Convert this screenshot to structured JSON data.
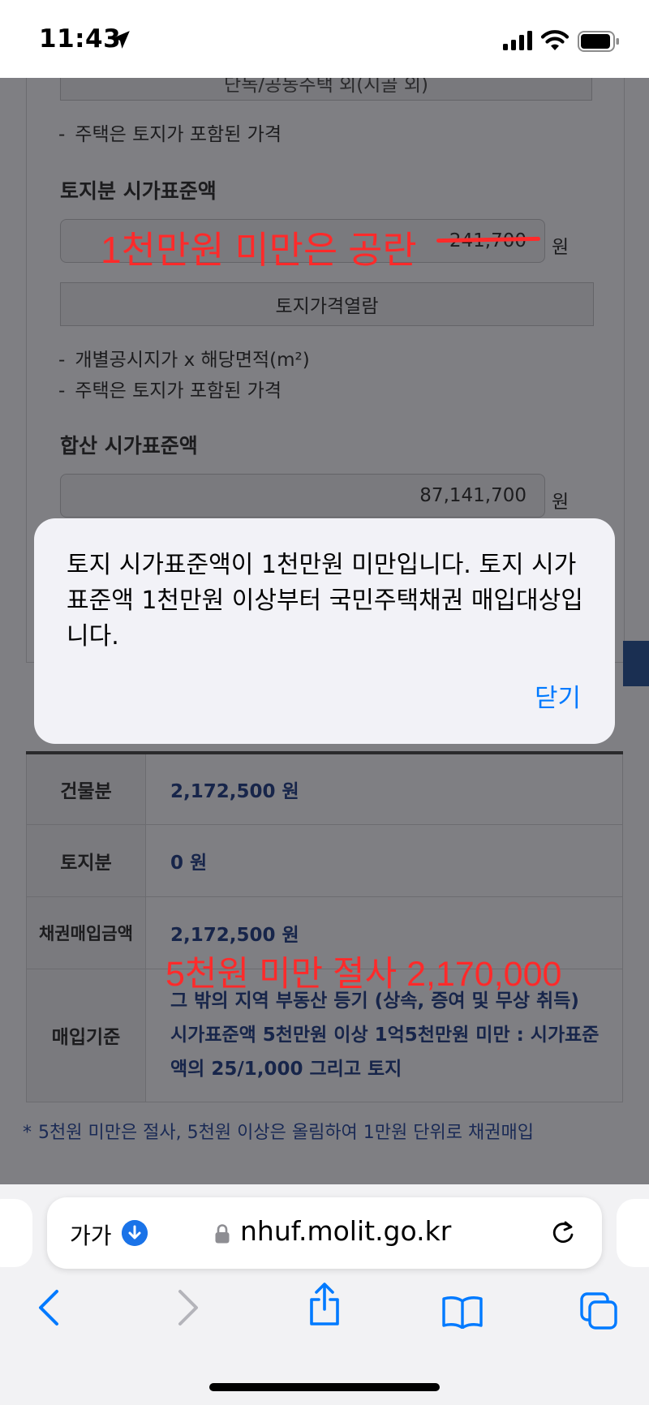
{
  "status_bar": {
    "time": "11:43"
  },
  "page": {
    "top_partial_button": "단독/공동주택 외(시골 외)",
    "note_house_land_1": "주택은 토지가 포함된 가격",
    "land_section_title": "토지분 시가표준액",
    "land_value": "241,700",
    "unit_won": "원",
    "land_price_button": "토지가격열람",
    "note_official_price": "개별공시지가 x 해당면적(m²)",
    "note_house_land_2": "주택은 토지가 포함된 가격",
    "total_section_title": "합산 시가표준액",
    "total_value": "87,141,700",
    "note_dash": "-"
  },
  "annotations": {
    "land_blank": "1천만원 미만은 공란",
    "truncate_note": "5천원 미만 절사 2,170,000"
  },
  "alert": {
    "message": "토지 시가표준액이 1천만원 미만입니다. 토지 시가표준액 1천만원 이상부터 국민주택채권 매입대상입니다.",
    "close_label": "닫기"
  },
  "result_table": {
    "rows": [
      {
        "label": "건물분",
        "value": "2,172,500 원"
      },
      {
        "label": "토지분",
        "value": "0 원"
      },
      {
        "label": "채권매입금액",
        "value": "2,172,500 원"
      },
      {
        "label": "매입기준",
        "value": "그 밖의 지역 부동산 등기 (상속, 증여 및 무상 취득) 시가표준액 5천만원 이상 1억5천만원 미만 : 시가표준액의 25/1,000 그리고 토지"
      }
    ]
  },
  "footnote": {
    "star": "*",
    "text": "5천원 미만은 절사, 5천원 이상은 올림하여 1만원 단위로 채권매입"
  },
  "browser": {
    "text_size_label": "가가",
    "url": "nhuf.molit.go.kr"
  },
  "colors": {
    "accent_blue": "#007aff",
    "annotation_red": "#ff2a2a"
  }
}
